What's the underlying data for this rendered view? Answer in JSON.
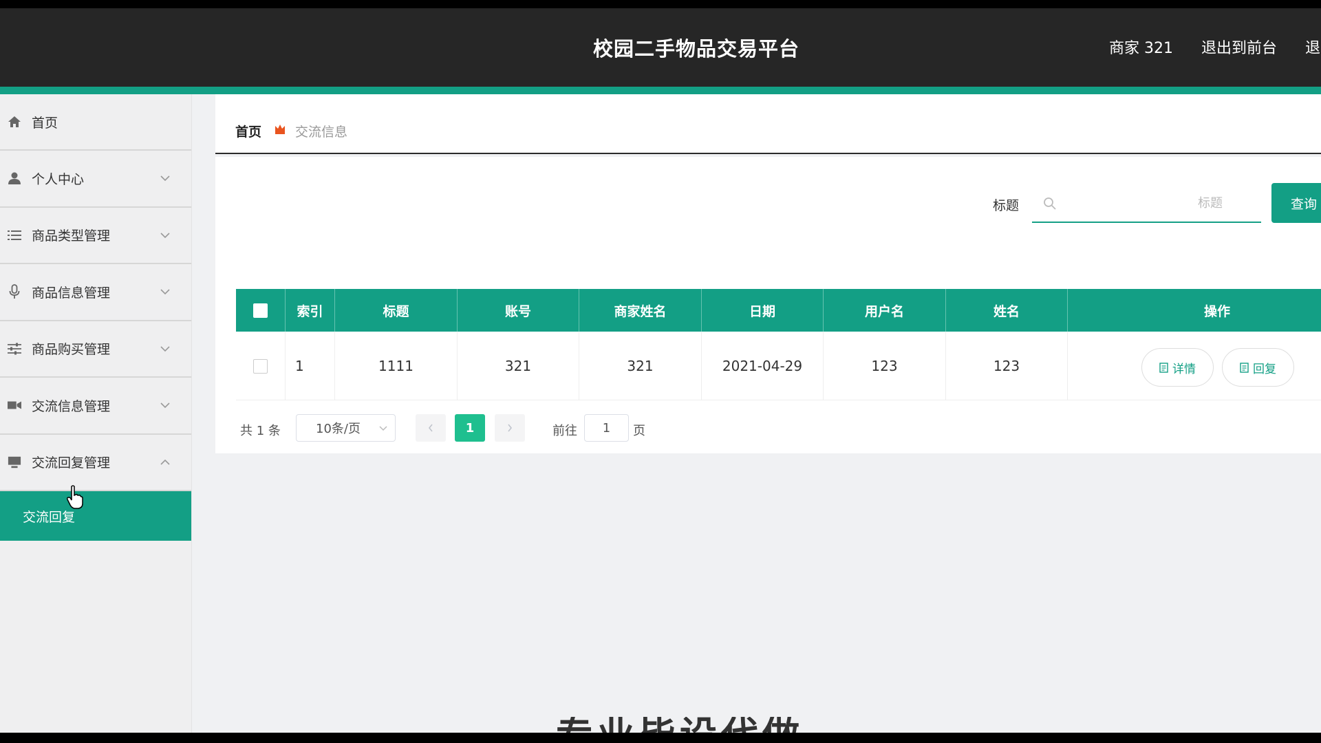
{
  "header": {
    "title": "校园二手物品交易平台",
    "user": "商家 321",
    "to_front": "退出到前台",
    "logout": "退出登录"
  },
  "sidebar": {
    "items": [
      {
        "label": "首页",
        "icon": "home-icon"
      },
      {
        "label": "个人中心",
        "icon": "user-icon"
      },
      {
        "label": "商品类型管理",
        "icon": "list-icon"
      },
      {
        "label": "商品信息管理",
        "icon": "microphone-icon"
      },
      {
        "label": "商品购买管理",
        "icon": "sliders-icon"
      },
      {
        "label": "交流信息管理",
        "icon": "video-icon"
      },
      {
        "label": "交流回复管理",
        "icon": "monitor-icon"
      }
    ],
    "active_sub": "交流回复"
  },
  "breadcrumb": {
    "home": "首页",
    "current": "交流信息"
  },
  "search": {
    "label": "标题",
    "placeholder": "标题",
    "button": "查询"
  },
  "table": {
    "columns": [
      "索引",
      "标题",
      "账号",
      "商家姓名",
      "日期",
      "用户名",
      "姓名",
      "操作"
    ],
    "rows": [
      {
        "index": "1",
        "title": "1111",
        "account": "321",
        "merchant_name": "321",
        "date": "2021-04-29",
        "username": "123",
        "name": "123"
      }
    ],
    "actions": {
      "detail": "详情",
      "reply": "回复"
    }
  },
  "pagination": {
    "total": "共 1 条",
    "page_size": "10条/页",
    "current": "1",
    "goto_label": "前往",
    "goto_value": "1",
    "page_suffix": "页"
  },
  "colors": {
    "accent": "#139f85",
    "header_bg": "#262626"
  },
  "overlay_text": "专业毕设代做"
}
